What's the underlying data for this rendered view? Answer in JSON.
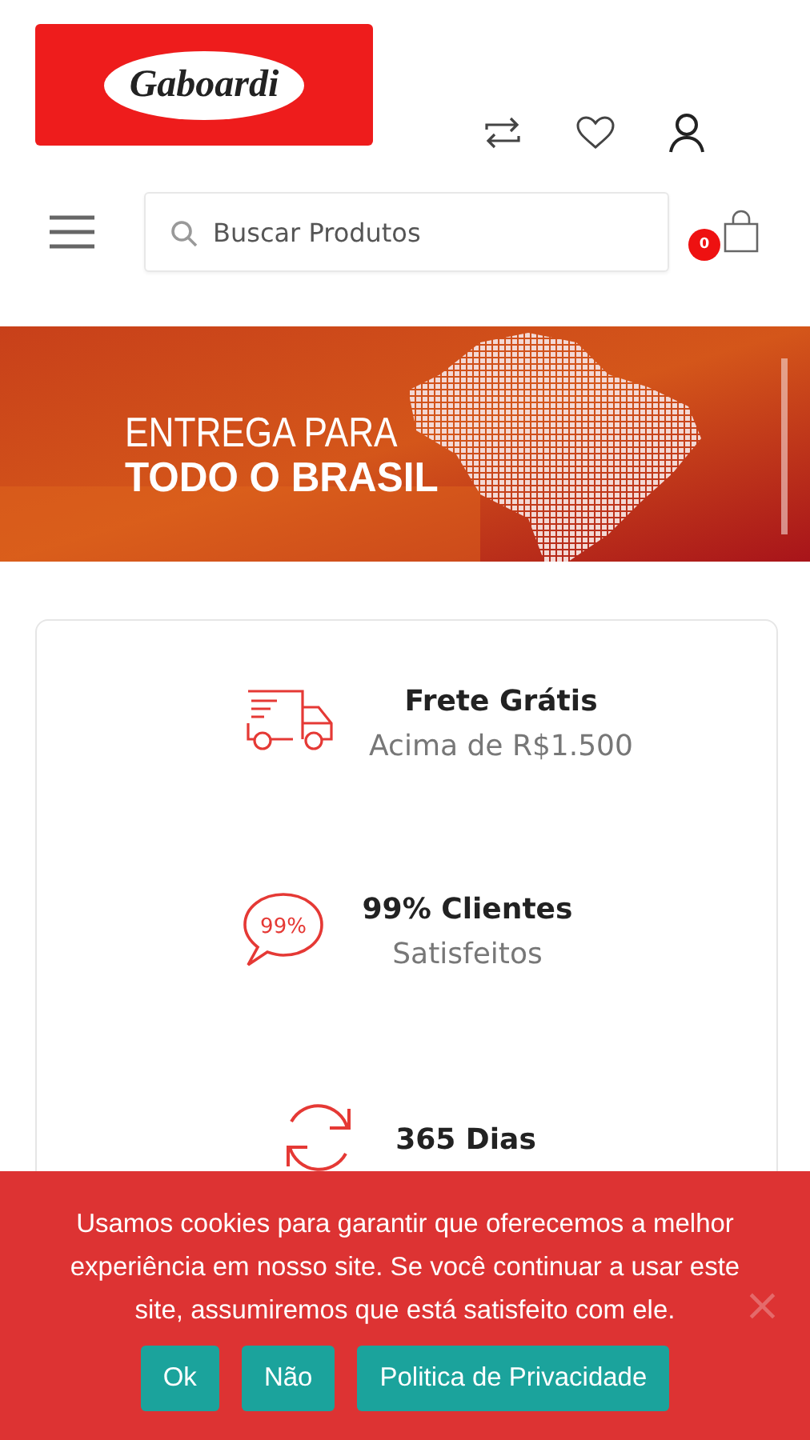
{
  "header": {
    "logo": "Gaboardi",
    "search": {
      "placeholder": "Buscar Produtos"
    },
    "cart_count": "0"
  },
  "banner": {
    "line_1": "ENTREGA PARA",
    "line_2": "TODO O BRASIL"
  },
  "features": [
    {
      "kind": "truck",
      "title": "Frete Grátis",
      "subtitle": "Acima de R$1.500"
    },
    {
      "kind": "bubble",
      "icon_text": "99%",
      "title": "99% Clientes",
      "subtitle": "Satisfeitos"
    },
    {
      "kind": "cycle",
      "title": "365 Dias"
    }
  ],
  "cookie_notice": {
    "text": "Usamos cookies para garantir que oferecemos a melhor experiência em nosso site. Se você continuar a usar este site, assumiremos que está satisfeito com ele.",
    "buttons": [
      "Ok",
      "Não",
      "Politica de Privacidade"
    ],
    "close": "×"
  }
}
